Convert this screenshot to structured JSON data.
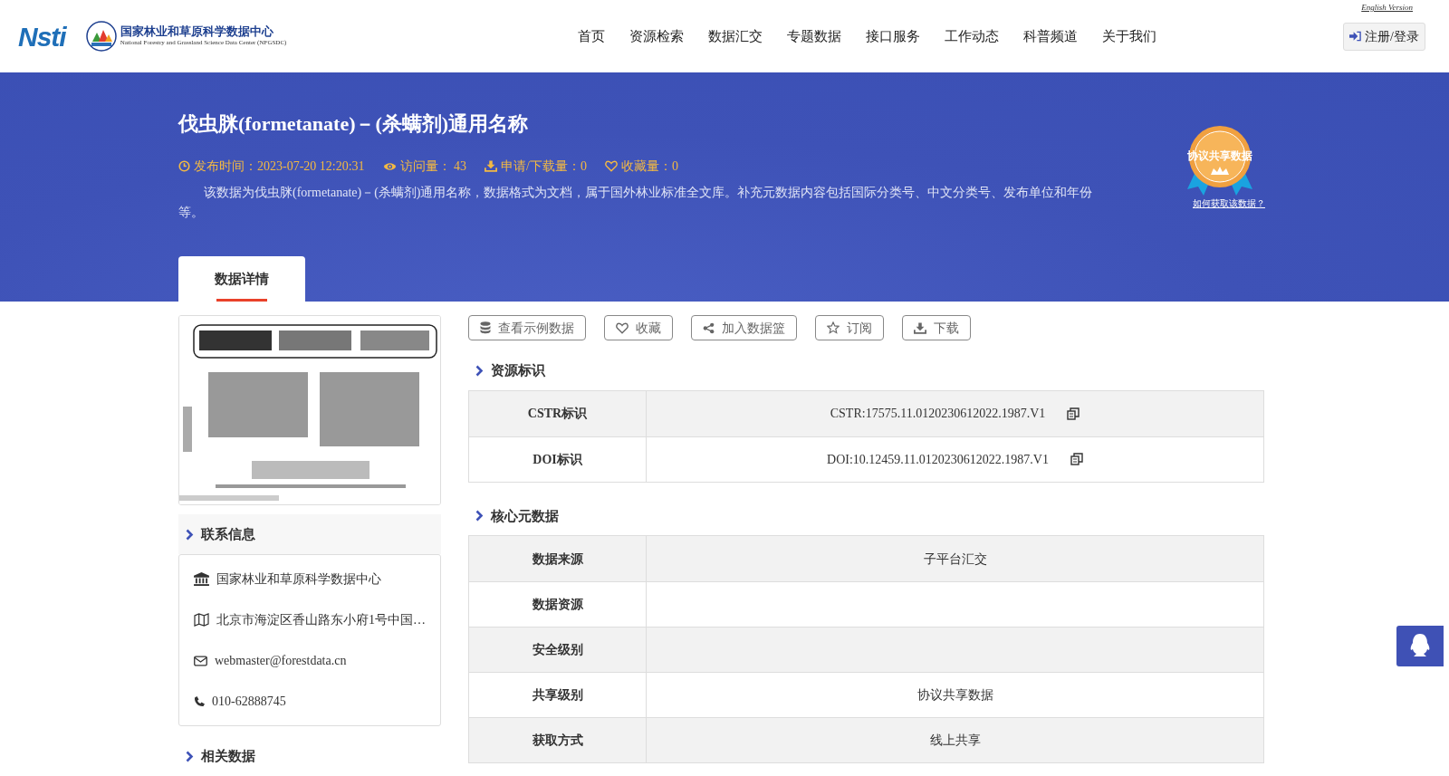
{
  "header": {
    "logo_text": "Nsti",
    "org_name": "国家林业和草原科学数据中心",
    "org_name_en": "National Forestry and Grassland Science Data Center (NFGSDC)",
    "english_link": "English Version",
    "login": "注册/登录",
    "nav": [
      {
        "label": "首页"
      },
      {
        "label": "资源检索"
      },
      {
        "label": "数据汇交"
      },
      {
        "label": "专题数据"
      },
      {
        "label": "接口服务"
      },
      {
        "label": "工作动态"
      },
      {
        "label": "科普频道"
      },
      {
        "label": "关于我们"
      }
    ]
  },
  "banner": {
    "title": "伐虫脒(formetanate)－(杀螨剂)通用名称",
    "meta": [
      {
        "kind": "clock",
        "text": "发布时间：2023-07-20 12:20:31"
      },
      {
        "kind": "eye",
        "text": "访问量： 43"
      },
      {
        "kind": "download",
        "text": "申请/下载量：0"
      },
      {
        "kind": "heart",
        "text": "收藏量：0"
      }
    ],
    "description": "该数据为伐虫脒(formetanate)－(杀螨剂)通用名称，数据格式为文档，属于国外林业标准全文库。补充元数据内容包括国际分类号、中文分类号、发布单位和年份等。",
    "badge": "协议共享数据",
    "badge_link": "如何获取该数据？"
  },
  "tabs": [
    {
      "label": "数据详情",
      "selected": true
    }
  ],
  "contact": {
    "title": "联系信息",
    "items": [
      {
        "kind": "org",
        "text": "国家林业和草原科学数据中心"
      },
      {
        "kind": "map",
        "text": "北京市海淀区香山路东小府1号中国…"
      },
      {
        "kind": "mail",
        "text": "webmaster@forestdata.cn"
      },
      {
        "kind": "phone",
        "text": "010-62888745"
      }
    ]
  },
  "related_title": "相关数据",
  "actions": [
    {
      "kind": "database",
      "label": "查看示例数据"
    },
    {
      "kind": "heart",
      "label": "收藏"
    },
    {
      "kind": "share",
      "label": "加入数据篮"
    },
    {
      "kind": "star",
      "label": "订阅"
    },
    {
      "kind": "download",
      "label": "下载"
    }
  ],
  "identifiers": {
    "title": "资源标识",
    "rows": [
      {
        "label": "CSTR标识",
        "value": "CSTR:17575.11.0120230612022.1987.V1"
      },
      {
        "label": "DOI标识",
        "value": "DOI:10.12459.11.0120230612022.1987.V1"
      }
    ]
  },
  "core": {
    "title": "核心元数据",
    "rows": [
      {
        "label": "数据来源",
        "value": "子平台汇交"
      },
      {
        "label": "数据资源"
      },
      {
        "label": "安全级别"
      },
      {
        "label": "共享级别",
        "value": "协议共享数据"
      },
      {
        "label": "获取方式",
        "value": "线上共享"
      }
    ]
  }
}
